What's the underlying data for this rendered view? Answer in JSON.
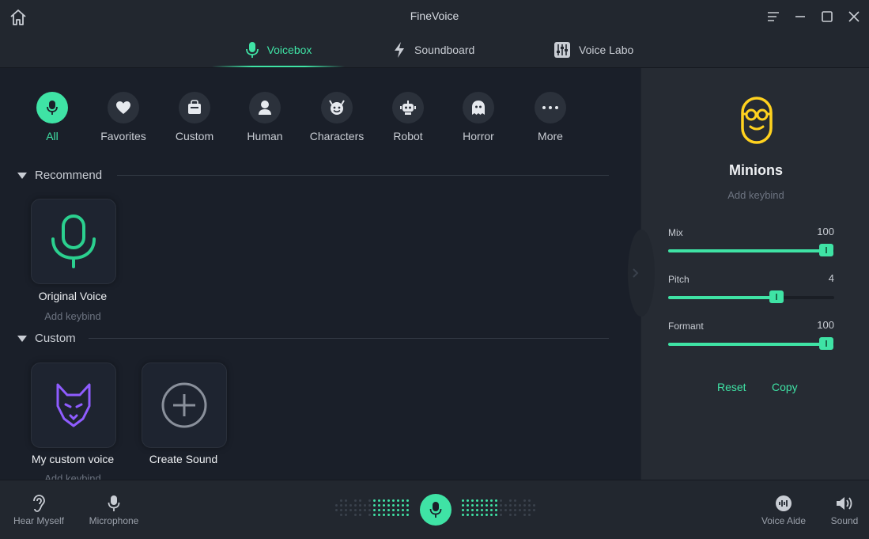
{
  "app": {
    "title": "FineVoice"
  },
  "tabs": [
    {
      "label": "Voicebox",
      "icon": "microphone-icon",
      "active": true
    },
    {
      "label": "Soundboard",
      "icon": "lightning-icon",
      "active": false
    },
    {
      "label": "Voice Labo",
      "icon": "sliders-icon",
      "active": false
    }
  ],
  "categories": [
    {
      "label": "All",
      "icon": "microphone-icon",
      "active": true
    },
    {
      "label": "Favorites",
      "icon": "heart-icon"
    },
    {
      "label": "Custom",
      "icon": "bag-icon"
    },
    {
      "label": "Human",
      "icon": "person-icon"
    },
    {
      "label": "Characters",
      "icon": "devil-icon"
    },
    {
      "label": "Robot",
      "icon": "robot-icon"
    },
    {
      "label": "Horror",
      "icon": "ghost-icon"
    },
    {
      "label": "More",
      "icon": "ellipsis-icon"
    }
  ],
  "sections": {
    "recommend": {
      "title": "Recommend",
      "items": [
        {
          "name": "Original Voice",
          "keybind": "Add keybind"
        }
      ]
    },
    "custom": {
      "title": "Custom",
      "items": [
        {
          "name": "My custom voice",
          "keybind": "Add keybind"
        },
        {
          "name": "Create Sound"
        }
      ]
    }
  },
  "selected_voice": {
    "name": "Minions",
    "keybind": "Add keybind",
    "sliders": [
      {
        "label": "Mix",
        "value": "100",
        "fraction": 0.95
      },
      {
        "label": "Pitch",
        "value": "4",
        "fraction": 0.65
      },
      {
        "label": "Formant",
        "value": "100",
        "fraction": 0.95
      }
    ],
    "reset_label": "Reset",
    "copy_label": "Copy"
  },
  "bottom_bar": {
    "hear_myself": "Hear Myself",
    "microphone": "Microphone",
    "voice_aide": "Voice Aide",
    "sound": "Sound"
  },
  "colors": {
    "accent": "#3fe3a5",
    "background": "#1a1f29",
    "panel": "#262b33"
  }
}
